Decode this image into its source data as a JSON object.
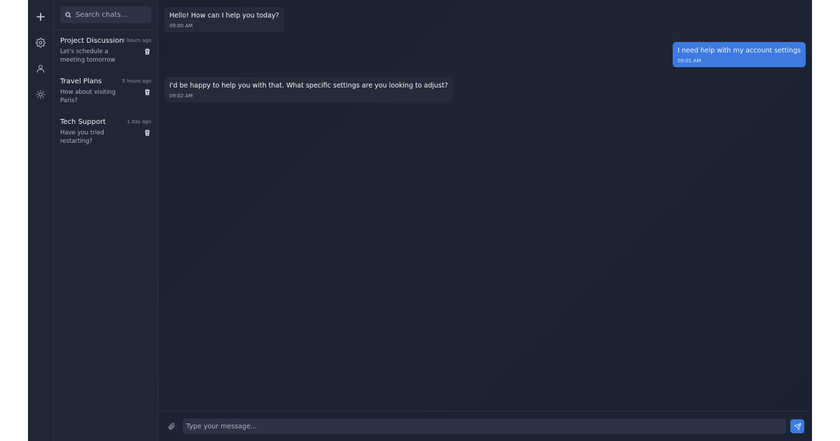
{
  "rail": {
    "icons": [
      "plus-icon",
      "gear-icon",
      "user-icon",
      "sun-icon"
    ]
  },
  "search": {
    "placeholder": "Search chats..."
  },
  "chats": [
    {
      "title": "Project Discussion",
      "time": "2 hours ago",
      "preview": "Let's schedule a meeting tomorrow"
    },
    {
      "title": "Travel Plans",
      "time": "5 hours ago",
      "preview": "How about visiting Paris?"
    },
    {
      "title": "Tech Support",
      "time": "1 day ago",
      "preview": "Have you tried restarting?"
    }
  ],
  "messages": [
    {
      "direction": "incoming",
      "text": "Hello! How can I help you today?",
      "time": "09:00 AM"
    },
    {
      "direction": "outgoing",
      "text": "I need help with my account settings",
      "time": "09:01 AM"
    },
    {
      "direction": "incoming",
      "text": "I'd be happy to help you with that. What specific settings are you looking to adjust?",
      "time": "09:02 AM"
    }
  ],
  "composer": {
    "placeholder": "Type your message..."
  },
  "colors": {
    "accent": "#3d7be0",
    "background": "#1b2232",
    "sidebar": "#1f2636"
  }
}
